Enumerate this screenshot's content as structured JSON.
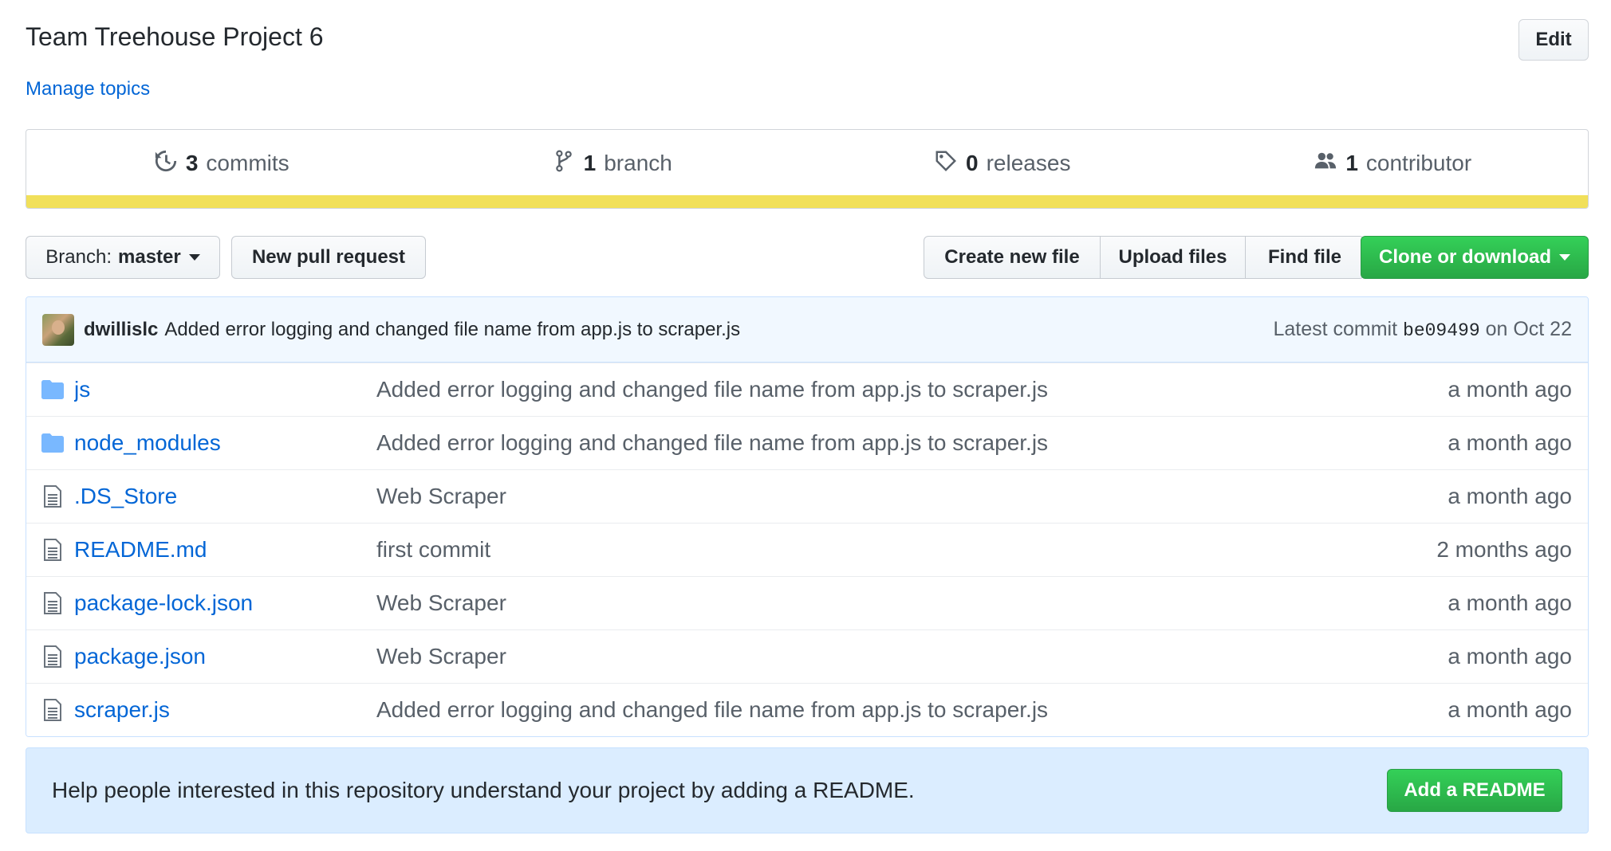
{
  "repo": {
    "title": "Team Treehouse Project 6",
    "edit_label": "Edit",
    "manage_topics": "Manage topics"
  },
  "summary": {
    "commits_count": "3",
    "commits_label": "commits",
    "branches_count": "1",
    "branches_label": "branch",
    "releases_count": "0",
    "releases_label": "releases",
    "contributors_count": "1",
    "contributors_label": "contributor",
    "language_bar_color": "#f1e05a"
  },
  "toolbar": {
    "branch_prefix": "Branch:",
    "branch_name": "master",
    "new_pr": "New pull request",
    "create_file": "Create new file",
    "upload_files": "Upload files",
    "find_file": "Find file",
    "clone": "Clone or download"
  },
  "latest_commit": {
    "author": "dwillislc",
    "message": "Added error logging and changed file name from app.js to scraper.js",
    "prefix": "Latest commit",
    "sha": "be09499",
    "date": "on Oct 22"
  },
  "files": [
    {
      "type": "folder",
      "icon": "folder-icon",
      "name": "js",
      "message": "Added error logging and changed file name from app.js to scraper.js",
      "age": "a month ago"
    },
    {
      "type": "folder",
      "icon": "folder-icon",
      "name": "node_modules",
      "message": "Added error logging and changed file name from app.js to scraper.js",
      "age": "a month ago"
    },
    {
      "type": "file",
      "icon": "file-icon",
      "name": ".DS_Store",
      "message": "Web Scraper",
      "age": "a month ago"
    },
    {
      "type": "file",
      "icon": "file-icon",
      "name": "README.md",
      "message": "first commit",
      "age": "2 months ago"
    },
    {
      "type": "file",
      "icon": "file-icon",
      "name": "package-lock.json",
      "message": "Web Scraper",
      "age": "a month ago"
    },
    {
      "type": "file",
      "icon": "file-icon",
      "name": "package.json",
      "message": "Web Scraper",
      "age": "a month ago"
    },
    {
      "type": "file",
      "icon": "file-icon",
      "name": "scraper.js",
      "message": "Added error logging and changed file name from app.js to scraper.js",
      "age": "a month ago"
    }
  ],
  "readme_prompt": {
    "text": "Help people interested in this repository understand your project by adding a README.",
    "button": "Add a README"
  },
  "colors": {
    "link": "#0366d6",
    "primary_button": "#28a745",
    "commit_bar_bg": "#f1f8ff",
    "readme_bg": "#dbedff"
  }
}
